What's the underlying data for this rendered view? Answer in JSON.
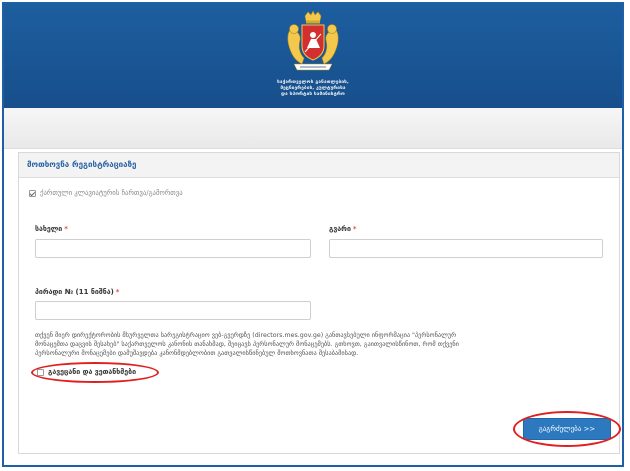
{
  "header": {
    "org_line_1": "საქართველოს განათლების,",
    "org_line_2": "მეცნიერების, კულტურისა",
    "org_line_3": "და სპორტის სამინისტრო",
    "emblem_icon": "georgia-coat-of-arms-icon"
  },
  "form": {
    "title": "მოთხოვნა რეგისტრაციაზე",
    "keyboard_checkbox_label": "ქართული კლავიატურის ჩართვა/გამორთვა",
    "first_name_label": "სახელი",
    "last_name_label": "გვარი",
    "personal_id_label": "პირადი № (11 ნიშნა)",
    "required_mark": "*",
    "first_name_value": "",
    "last_name_value": "",
    "personal_id_value": "",
    "notice_text": "თქვენ მიერ დირექტორობის მსურველთა სარეგისტრაციო ვებ-გვერდზე (directors.mes.gov.ge) განთავსებული ინფორმაცია \"პერსონალურ მონაცემთა დაცვის შესახებ\" საქართველოს კანონის თანახმად, შეიცავს პერსონალურ მონაცემებს. გთხოვთ, გაითვალისწინოთ, რომ თქვენი პერსონალური მონაცემები დამუშავდება კანონმდებლობით გათვალისწინებულ მოთხოვნათა შესაბამისად.",
    "agree_label": "გავეცანი და ვეთანხმები",
    "next_button": "გაგრძელება >>"
  },
  "colors": {
    "header_blue": "#1d5ea0",
    "link_blue": "#2a63a3",
    "button_blue": "#2d79c0",
    "annotation_red": "#e01f1f"
  }
}
